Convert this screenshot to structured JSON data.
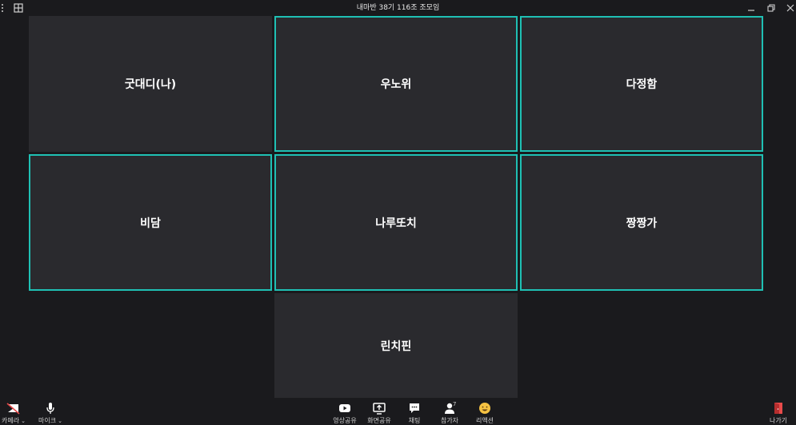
{
  "window": {
    "title": "내마반 38기 116조 조모임"
  },
  "participants": [
    {
      "name": "굿대디(나)",
      "active": false
    },
    {
      "name": "우노위",
      "active": true
    },
    {
      "name": "다정함",
      "active": true
    },
    {
      "name": "비담",
      "active": true
    },
    {
      "name": "나루또치",
      "active": true
    },
    {
      "name": "짱짱가",
      "active": true
    },
    {
      "name": "린치핀",
      "active": false
    }
  ],
  "toolbar": {
    "camera_label": "카메라",
    "mic_label": "마이크",
    "share_video_label": "영상공유",
    "share_screen_label": "화면공유",
    "chat_label": "채팅",
    "participants_label": "참가자",
    "participants_count": "7",
    "reaction_label": "리액션",
    "leave_label": "나가기"
  },
  "colors": {
    "background": "#1a1a1d",
    "tile": "#2a2a2e",
    "active_border": "#1fc0b4",
    "leave": "#e84a4a",
    "reaction": "#f5c242"
  }
}
